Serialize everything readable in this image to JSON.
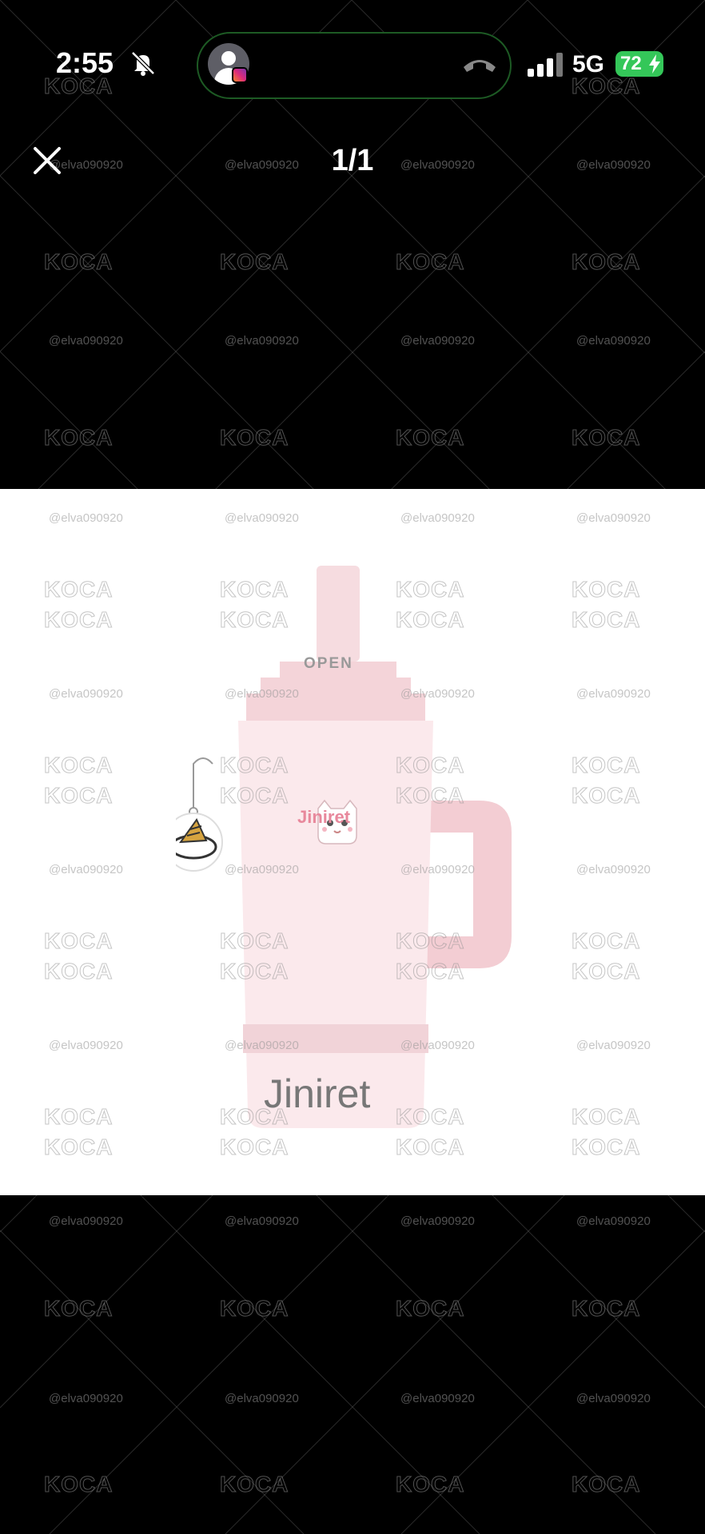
{
  "status_bar": {
    "time": "2:55",
    "network": "5G",
    "battery": "72",
    "icons": [
      "bell-slash-icon",
      "avatar-icon",
      "instagram-icon",
      "hang-up-icon",
      "signal-icon",
      "charging-bolt-icon"
    ]
  },
  "viewer": {
    "counter": "1/1",
    "close_icon": "close-icon"
  },
  "image": {
    "caption": "Jiniret",
    "cup_label": "Jiniret",
    "lid_label": "OPEN"
  },
  "watermark": {
    "logo": "KOCA",
    "handle": "@elva090920"
  },
  "colors": {
    "background": "#000000",
    "image_bg": "#ffffff",
    "tumbler": "#f6dce0",
    "battery": "#34c759"
  }
}
